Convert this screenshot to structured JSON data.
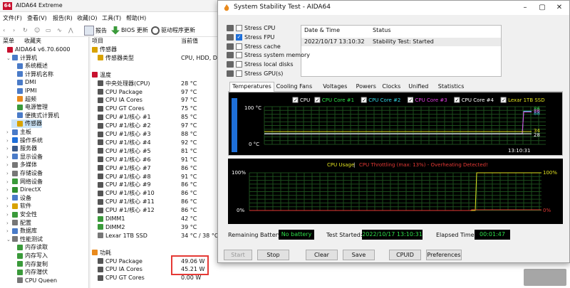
{
  "main": {
    "title": "AIDA64 Extreme",
    "menu": [
      "文件(F)",
      "查看(V)",
      "报告(R)",
      "收藏(O)",
      "工具(T)",
      "帮助(H)"
    ],
    "toolbar": {
      "report": "报告",
      "bios": "BIOS 更新",
      "driver": "驱动程序更新"
    },
    "tree_header": {
      "menu": "菜单",
      "fav": "收藏夹"
    },
    "tree": [
      {
        "label": "AIDA64 v6.70.6000",
        "indent": 0,
        "arrow": "",
        "color": "#c8102e"
      },
      {
        "label": "计算机",
        "indent": 1,
        "arrow": "⌄",
        "color": "#4a7bc8"
      },
      {
        "label": "系统概述",
        "indent": 2,
        "arrow": "",
        "color": "#4a7bc8"
      },
      {
        "label": "计算机名称",
        "indent": 2,
        "arrow": "",
        "color": "#4a7bc8"
      },
      {
        "label": "DMI",
        "indent": 2,
        "arrow": "",
        "color": "#4a7bc8"
      },
      {
        "label": "IPMI",
        "indent": 2,
        "arrow": "",
        "color": "#4a7bc8"
      },
      {
        "label": "超频",
        "indent": 2,
        "arrow": "",
        "color": "#e98a1d"
      },
      {
        "label": "电源管理",
        "indent": 2,
        "arrow": "",
        "color": "#3a9a3a"
      },
      {
        "label": "便携式计算机",
        "indent": 2,
        "arrow": "",
        "color": "#4a7bc8"
      },
      {
        "label": "传感器",
        "indent": 2,
        "arrow": "",
        "color": "#d8a200",
        "selected": true
      },
      {
        "label": "主板",
        "indent": 1,
        "arrow": "›",
        "color": "#4a7bc8"
      },
      {
        "label": "操作系统",
        "indent": 1,
        "arrow": "›",
        "color": "#1e6fd9"
      },
      {
        "label": "服务器",
        "indent": 1,
        "arrow": "›",
        "color": "#3a5a8a"
      },
      {
        "label": "显示设备",
        "indent": 1,
        "arrow": "›",
        "color": "#4a7bc8"
      },
      {
        "label": "多媒体",
        "indent": 1,
        "arrow": "›",
        "color": "#777777"
      },
      {
        "label": "存储设备",
        "indent": 1,
        "arrow": "›",
        "color": "#777777"
      },
      {
        "label": "网络设备",
        "indent": 1,
        "arrow": "›",
        "color": "#3a9a3a"
      },
      {
        "label": "DirectX",
        "indent": 1,
        "arrow": "›",
        "color": "#2f8f2f"
      },
      {
        "label": "设备",
        "indent": 1,
        "arrow": "›",
        "color": "#4a7bc8"
      },
      {
        "label": "软件",
        "indent": 1,
        "arrow": "›",
        "color": "#d8a200"
      },
      {
        "label": "安全性",
        "indent": 1,
        "arrow": "›",
        "color": "#3a9a3a"
      },
      {
        "label": "配置",
        "indent": 1,
        "arrow": "›",
        "color": "#777777"
      },
      {
        "label": "数据库",
        "indent": 1,
        "arrow": "›",
        "color": "#4a7bc8"
      },
      {
        "label": "性能测试",
        "indent": 1,
        "arrow": "⌄",
        "color": "#777777"
      },
      {
        "label": "内存读取",
        "indent": 2,
        "arrow": "",
        "color": "#3a9a3a"
      },
      {
        "label": "内存写入",
        "indent": 2,
        "arrow": "",
        "color": "#3a9a3a"
      },
      {
        "label": "内存复制",
        "indent": 2,
        "arrow": "",
        "color": "#3a9a3a"
      },
      {
        "label": "内存潜伏",
        "indent": 2,
        "arrow": "",
        "color": "#3a9a3a"
      },
      {
        "label": "CPU Queen",
        "indent": 2,
        "arrow": "",
        "color": "#777777"
      }
    ],
    "columns": {
      "item": "项目",
      "value": "当前值"
    },
    "list": [
      {
        "label": "传感器",
        "value": "",
        "section": true,
        "color": "#d8a200"
      },
      {
        "label": "传感器类型",
        "value": "CPU, HDD, DIM",
        "indent": true,
        "color": "#d8a200"
      },
      {
        "label": "",
        "value": "",
        "spacer": true
      },
      {
        "label": "温度",
        "value": "",
        "section": true,
        "color": "#c8102e"
      },
      {
        "label": "中央处理器(CPU)",
        "value": "28 °C",
        "indent": true,
        "color": "#555555"
      },
      {
        "label": "CPU Package",
        "value": "97 °C",
        "indent": true,
        "color": "#555555"
      },
      {
        "label": "CPU IA Cores",
        "value": "97 °C",
        "indent": true,
        "color": "#555555"
      },
      {
        "label": "CPU GT Cores",
        "value": "75 °C",
        "indent": true,
        "color": "#555555"
      },
      {
        "label": "CPU #1/核心 #1",
        "value": "85 °C",
        "indent": true,
        "color": "#555555"
      },
      {
        "label": "CPU #1/核心 #2",
        "value": "97 °C",
        "indent": true,
        "color": "#555555"
      },
      {
        "label": "CPU #1/核心 #3",
        "value": "88 °C",
        "indent": true,
        "color": "#555555"
      },
      {
        "label": "CPU #1/核心 #4",
        "value": "92 °C",
        "indent": true,
        "color": "#555555"
      },
      {
        "label": "CPU #1/核心 #5",
        "value": "81 °C",
        "indent": true,
        "color": "#555555"
      },
      {
        "label": "CPU #1/核心 #6",
        "value": "91 °C",
        "indent": true,
        "color": "#555555"
      },
      {
        "label": "CPU #1/核心 #7",
        "value": "86 °C",
        "indent": true,
        "color": "#555555"
      },
      {
        "label": "CPU #1/核心 #8",
        "value": "91 °C",
        "indent": true,
        "color": "#555555"
      },
      {
        "label": "CPU #1/核心 #9",
        "value": "86 °C",
        "indent": true,
        "color": "#555555"
      },
      {
        "label": "CPU #1/核心 #10",
        "value": "86 °C",
        "indent": true,
        "color": "#555555"
      },
      {
        "label": "CPU #1/核心 #11",
        "value": "86 °C",
        "indent": true,
        "color": "#555555"
      },
      {
        "label": "CPU #1/核心 #12",
        "value": "86 °C",
        "indent": true,
        "color": "#555555"
      },
      {
        "label": "DIMM1",
        "value": "42 °C",
        "indent": true,
        "color": "#3a9a3a"
      },
      {
        "label": "DIMM2",
        "value": "39 °C",
        "indent": true,
        "color": "#3a9a3a"
      },
      {
        "label": "Lexar 1TB SSD",
        "value": "34 °C / 38 °C",
        "indent": true,
        "color": "#777777"
      },
      {
        "label": "",
        "value": "",
        "spacer": true
      },
      {
        "label": "功耗",
        "value": "",
        "section": true,
        "color": "#e98a1d"
      },
      {
        "label": "CPU Package",
        "value": "49.06 W",
        "indent": true,
        "color": "#555555"
      },
      {
        "label": "CPU IA Cores",
        "value": "45.21 W",
        "indent": true,
        "color": "#555555"
      },
      {
        "label": "CPU GT Cores",
        "value": "0.00 W",
        "indent": true,
        "color": "#555555"
      }
    ]
  },
  "stab": {
    "title": "System Stability Test - AIDA64",
    "stress": [
      {
        "label": "Stress CPU",
        "checked": false
      },
      {
        "label": "Stress FPU",
        "checked": true
      },
      {
        "label": "Stress cache",
        "checked": false
      },
      {
        "label": "Stress system memory",
        "checked": false
      },
      {
        "label": "Stress local disks",
        "checked": false
      },
      {
        "label": "Stress GPU(s)",
        "checked": false
      }
    ],
    "status_header": {
      "date": "Date & Time",
      "status": "Status"
    },
    "status_row": {
      "date": "2022/10/17 13:10:32",
      "status": "Stability Test: Started"
    },
    "tabs": [
      "Temperatures",
      "Cooling Fans",
      "Voltages",
      "Powers",
      "Clocks",
      "Unified",
      "Statistics"
    ],
    "legend": [
      {
        "label": "CPU",
        "color": "#ffffff"
      },
      {
        "label": "CPU Core #1",
        "color": "#2ee04a"
      },
      {
        "label": "CPU Core #2",
        "color": "#33d6e6"
      },
      {
        "label": "CPU Core #3",
        "color": "#e040e0"
      },
      {
        "label": "CPU Core #4",
        "color": "#ffffff"
      },
      {
        "label": "Lexar 1TB SSD",
        "color": "#e0e020"
      }
    ],
    "temp_axis": {
      "top": "100 °C",
      "bottom": "0 °C"
    },
    "temp_time": "13:10:31",
    "temp_end_values": [
      "86",
      "88",
      "86",
      "28",
      "34"
    ],
    "usage_title": "CPU Usage",
    "usage_sep": "|",
    "usage_throttle": "CPU Throttling (max: 13%) - Overheating Detected!",
    "usage_axis": {
      "top": "100%",
      "bottom": "0%"
    },
    "usage_right": {
      "top": "100%",
      "bottom": "0%"
    },
    "bottom": {
      "battery_label": "Remaining Battery:",
      "battery": "No battery",
      "started_label": "Test Started:",
      "started": "2022/10/17 13:10:31",
      "elapsed_label": "Elapsed Time:",
      "elapsed": "00:01:47"
    },
    "buttons": {
      "start": "Start",
      "stop": "Stop",
      "clear": "Clear",
      "save": "Save",
      "cpuid": "CPUID",
      "prefs": "Preferences"
    }
  },
  "colors": {
    "accent": "#1e6fd9",
    "highlight": "#e53935",
    "chart_bg": "#000000",
    "readout": "#2ee04a"
  }
}
